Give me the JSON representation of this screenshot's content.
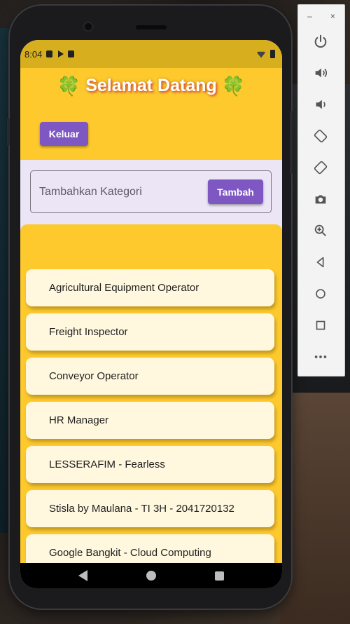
{
  "status": {
    "time": "8:04"
  },
  "header": {
    "clover_left": "🍀",
    "title": "Selamat Datang",
    "clover_right": "🍀",
    "logout_label": "Keluar"
  },
  "category_form": {
    "placeholder": "Tambahkan Kategori",
    "value": "",
    "add_label": "Tambah"
  },
  "items": [
    "Agricultural Equipment Operator",
    "Freight Inspector",
    "Conveyor Operator",
    "HR Manager",
    "LESSERAFIM - Fearless",
    "Stisla by Maulana - TI 3H - 2041720132",
    "Google Bangkit - Cloud Computing"
  ],
  "emulator_toolbar": {
    "minimize": "–",
    "close": "×",
    "buttons": [
      "power-icon",
      "volume-up-icon",
      "volume-down-icon",
      "rotate-left-icon",
      "rotate-right-icon",
      "camera-icon",
      "zoom-icon",
      "back-icon",
      "home-icon",
      "overview-icon",
      "more-icon"
    ]
  },
  "colors": {
    "header_bg": "#fdc92d",
    "statusbar_bg": "#d7af1e",
    "button_bg": "#7e57c2",
    "item_bg": "#fff8df",
    "form_bg": "#ebe5f5"
  }
}
